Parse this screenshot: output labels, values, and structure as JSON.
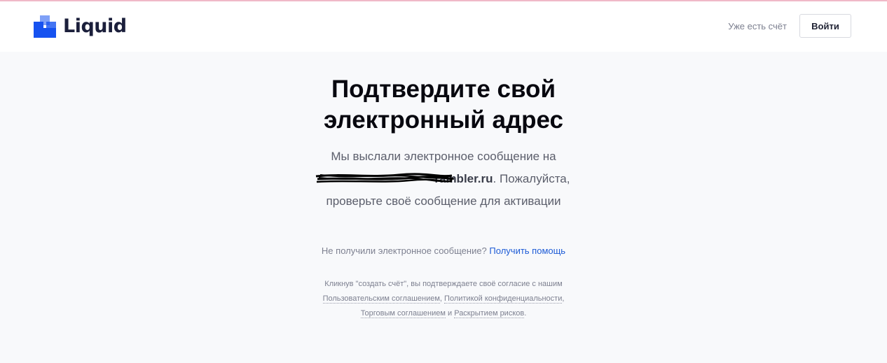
{
  "colors": {
    "brand": "#1652f0",
    "link": "#1d5bd6",
    "background": "#f8f9fb"
  },
  "header": {
    "logo_text": "Liquid",
    "have_account": "Уже есть счёт",
    "login_label": "Войти"
  },
  "main": {
    "title_line1": "Подтвердите свой",
    "title_line2": "электронный адрес",
    "message_before": "Мы выслали электронное сообщение на",
    "email_visible": "rambler.ru",
    "message_after": ". Пожалуйста, проверьте своё сообщение для активации"
  },
  "help": {
    "question": "Не получили электронное сообщение?",
    "link_label": "Получить помощь"
  },
  "legal": {
    "intro": "Кликнув \"создать счёт\", вы подтверждаете своё согласие с нашим",
    "user_agreement": "Пользовательским соглашением",
    "comma1": ",",
    "privacy_policy": "Политикой конфиденциальности",
    "comma2": ",",
    "trading_agreement": "Торговым соглашением",
    "and": "и",
    "risk_disclosure": "Раскрытием рисков",
    "period": "."
  }
}
